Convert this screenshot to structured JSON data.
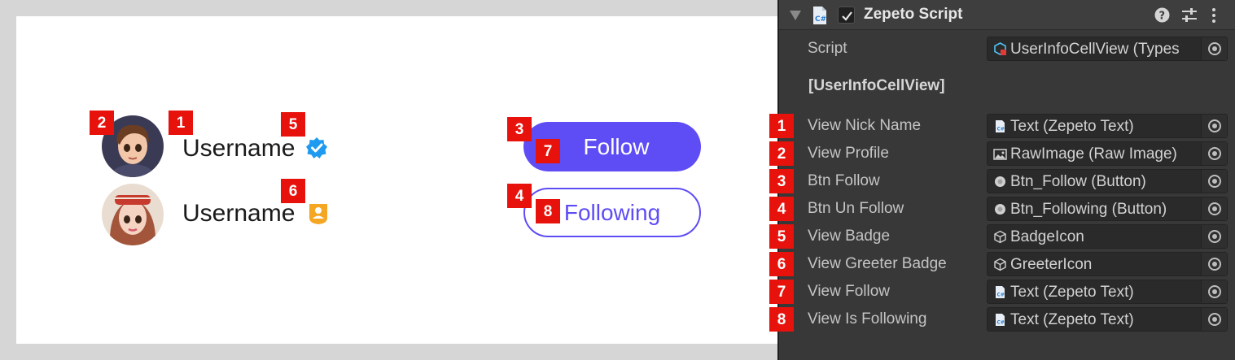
{
  "preview": {
    "users": [
      {
        "username": "Username",
        "badge": "verified-badge-icon"
      },
      {
        "username": "Username",
        "badge": "greeter-badge-icon"
      }
    ],
    "follow_button": "Follow",
    "following_button": "Following",
    "markers": {
      "username_1": "1",
      "avatar_1": "2",
      "follow_btn": "3",
      "following_btn": "4",
      "badge": "5",
      "greeter_badge": "6",
      "follow_text": "7",
      "following_text": "8"
    }
  },
  "inspector": {
    "component_title": "Zepeto Script",
    "enabled": true,
    "script_label": "Script",
    "script_value": "UserInfoCellView (Types",
    "section_title": "[UserInfoCellView]",
    "rows": [
      {
        "num": "1",
        "label": "View Nick Name",
        "value": "Text (Zepeto Text)",
        "icon": "script-file-icon"
      },
      {
        "num": "2",
        "label": "View Profile",
        "value": "RawImage (Raw Image)",
        "icon": "image-icon"
      },
      {
        "num": "3",
        "label": "Btn Follow",
        "value": "Btn_Follow (Button)",
        "icon": "button-icon"
      },
      {
        "num": "4",
        "label": "Btn Un Follow",
        "value": "Btn_Following (Button)",
        "icon": "button-icon"
      },
      {
        "num": "5",
        "label": "View Badge",
        "value": "BadgeIcon",
        "icon": "gameobject-cube-icon"
      },
      {
        "num": "6",
        "label": "View Greeter Badge",
        "value": "GreeterIcon",
        "icon": "gameobject-cube-icon"
      },
      {
        "num": "7",
        "label": "View Follow",
        "value": "Text (Zepeto Text)",
        "icon": "script-file-icon"
      },
      {
        "num": "8",
        "label": "View Is Following",
        "value": "Text (Zepeto Text)",
        "icon": "script-file-icon"
      }
    ],
    "colors": {
      "marker": "#e8120c",
      "accent": "#5e4cf4",
      "panel": "#383838"
    }
  }
}
